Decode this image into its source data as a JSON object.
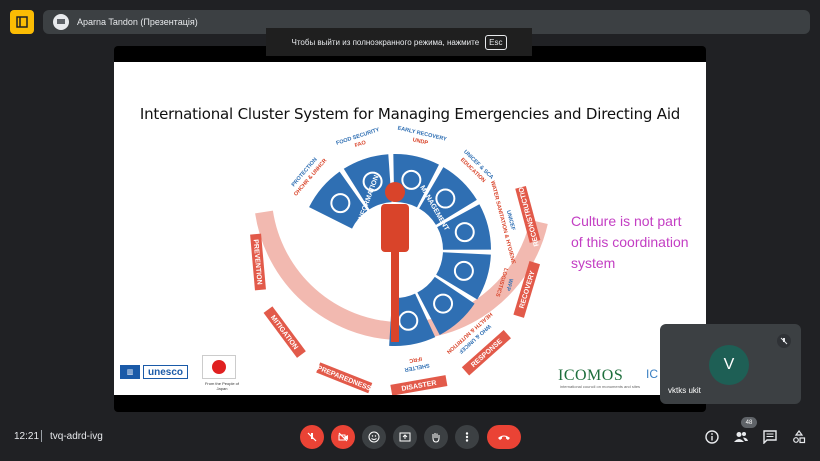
{
  "topbar": {
    "presenter": "Aparna Tandon (Презентація)"
  },
  "fullscreen_hint": {
    "text": "Чтобы выйти из полноэкранного режима, нажмите",
    "key": "Esc"
  },
  "slide": {
    "title": "International  Cluster System for Managing Emergencies and Directing Aid",
    "note": "Culture is not part of this coordination system",
    "clusters": [
      {
        "top": "PROTECTION",
        "bottom": "OHCHR & UNHCR"
      },
      {
        "top": "FOOD SECURITY",
        "bottom": "FAO"
      },
      {
        "top": "EARLY RECOVERY",
        "bottom": "UNDP"
      },
      {
        "top": "UNICEF & SCA",
        "bottom": "EDUCATION"
      },
      {
        "top": "UNICEF",
        "bottom": "WATER SANITATION & HYGIENE"
      },
      {
        "top": "WFP",
        "bottom": "LOGISTICS"
      },
      {
        "top": "WHO & UNICEF",
        "bottom": "HEALTH & NUTRITION"
      },
      {
        "top": "SHELTER",
        "bottom": "IFRC"
      }
    ],
    "inner_labels": [
      "INFORMATION",
      "MANAGEMENT"
    ],
    "cycle": [
      "PREVENTION",
      "MITIGATION",
      "PREPAREDNESS",
      "DISASTER",
      "RESPONSE",
      "RECOVERY",
      "RECONSTRUCTION"
    ],
    "logos": {
      "unesco": "unesco",
      "japan_caption": "From the People of Japan",
      "icomos": "ICOMOS",
      "icomos_sub": "international council on monuments and sites",
      "partial": "IC"
    }
  },
  "participant": {
    "initial": "V",
    "name": "vktks ukit"
  },
  "bottombar": {
    "time": "12:21",
    "meeting_code": "tvq-adrd-ivg",
    "participants_count": "48"
  },
  "colors": {
    "accent_red": "#ea4335",
    "cluster_blue": "#2f6fb3",
    "figure_red": "#d9442a",
    "ring_red": "#e25a4a",
    "note_magenta": "#c33ec3"
  }
}
